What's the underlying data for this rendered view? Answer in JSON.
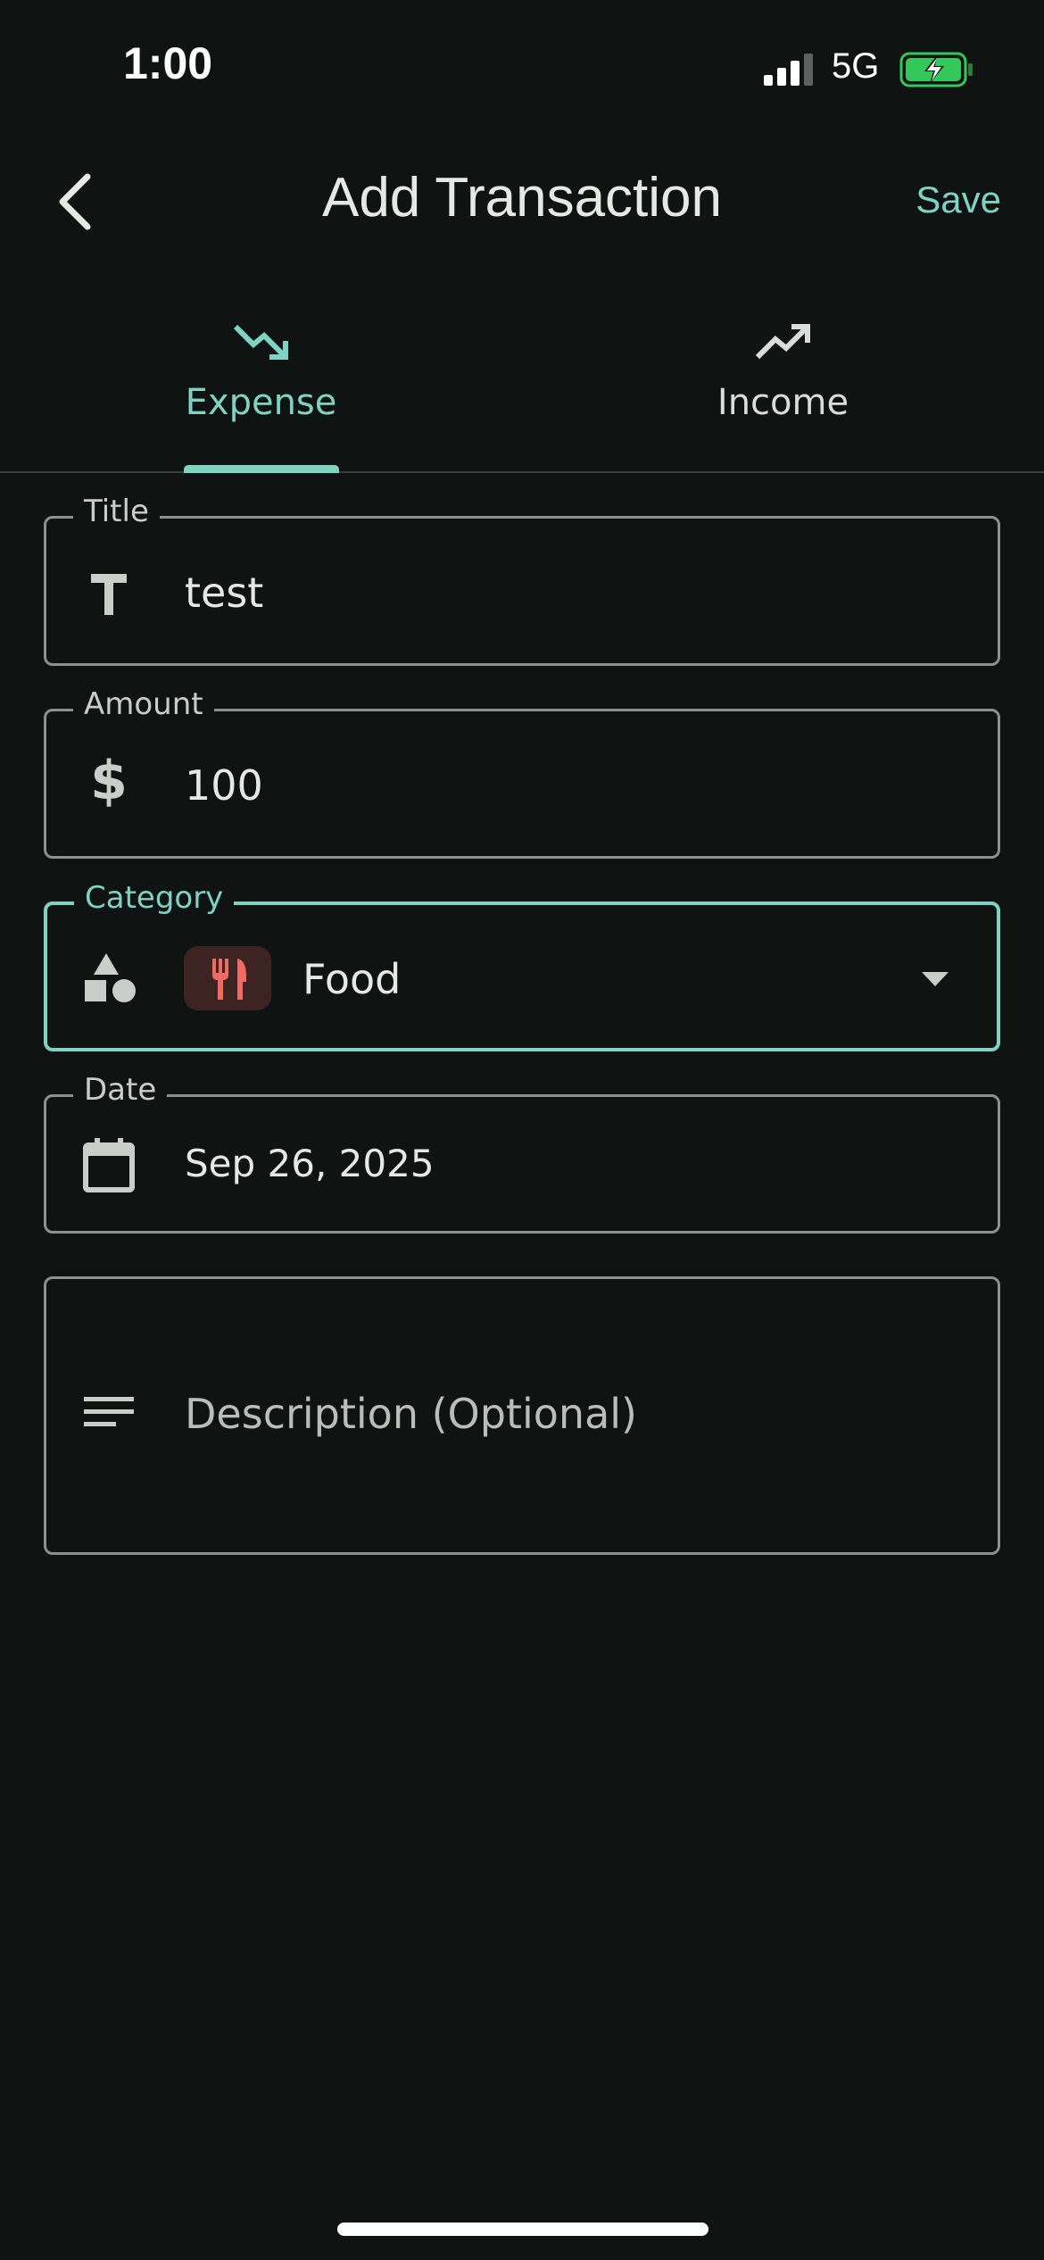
{
  "status_bar": {
    "time": "1:00",
    "network": "5G",
    "battery_charging": true
  },
  "header": {
    "title": "Add Transaction",
    "save_label": "Save",
    "back_icon": "chevron-left-icon"
  },
  "tabs": [
    {
      "label": "Expense",
      "icon": "trending-down-icon",
      "selected": true
    },
    {
      "label": "Income",
      "icon": "trending-up-icon",
      "selected": false
    }
  ],
  "form": {
    "title": {
      "label": "Title",
      "value": "test",
      "icon": "text-t-icon"
    },
    "amount": {
      "label": "Amount",
      "value": "100",
      "icon": "dollar-icon"
    },
    "category": {
      "label": "Category",
      "value": "Food",
      "icon": "shapes-icon",
      "chip_icon": "fork-knife-icon"
    },
    "date": {
      "label": "Date",
      "value": "Sep 26, 2025",
      "icon": "calendar-icon"
    },
    "description": {
      "placeholder": "Description (Optional)",
      "icon": "notes-icon"
    }
  },
  "colors": {
    "accent": "#7fd3c4",
    "background": "#0f1413",
    "food_chip_bg": "#3d2423",
    "food_icon": "#ef6b64",
    "battery": "#34c759"
  }
}
